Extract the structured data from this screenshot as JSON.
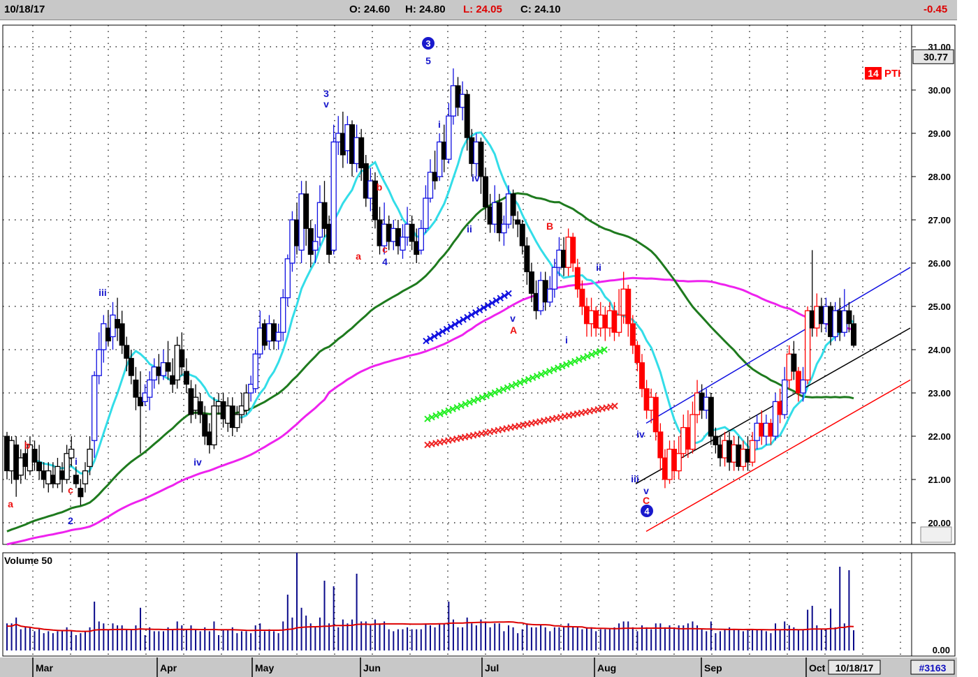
{
  "header": {
    "date": "10/18/17",
    "open": "O: 24.60",
    "high": "H: 24.80",
    "low": "L: 24.05",
    "close": "C: 24.10",
    "change": "-0.45"
  },
  "price_tag": "30.77",
  "pti": {
    "value": "14",
    "label": "PTI"
  },
  "volume_label": "Volume 50",
  "volume_axis_label": "0.00",
  "date_badge": "10/18/17",
  "chart_id": "#3163",
  "colors": {
    "up": "#1010e0",
    "down": "#000000",
    "red_phase": "#ff0000",
    "ma_fast": "#33dde8",
    "ma_mid": "#1e7a1e",
    "ma_slow": "#ee22ee",
    "volume": "#0a0a8a",
    "volume_avg": "#dd0000"
  },
  "chart_data": {
    "type": "candlestick",
    "y_ticks": [
      "31.00",
      "30.00",
      "29.00",
      "28.00",
      "27.00",
      "26.00",
      "25.00",
      "24.00",
      "23.00",
      "22.00",
      "21.00",
      "20.00"
    ],
    "ylim": [
      19.5,
      31.5
    ],
    "x_ticks": [
      "Mar",
      "Apr",
      "May",
      "Jun",
      "Jul",
      "Aug",
      "Sep",
      "Oct"
    ],
    "candles": [
      [
        22.0,
        21.2,
        22.1,
        21.0
      ],
      [
        21.2,
        21.9,
        22.0,
        20.9
      ],
      [
        21.8,
        21.0,
        22.0,
        20.6
      ],
      [
        21.1,
        21.5,
        21.7,
        20.9
      ],
      [
        21.6,
        21.3,
        21.9,
        21.0
      ],
      [
        21.2,
        21.8,
        22.0,
        21.1
      ],
      [
        21.7,
        21.4,
        21.9,
        21.2
      ],
      [
        21.4,
        21.2,
        21.8,
        21.0
      ],
      [
        21.2,
        21.0,
        21.4,
        20.8
      ],
      [
        20.9,
        21.2,
        21.4,
        20.7
      ],
      [
        21.1,
        20.9,
        21.4,
        20.8
      ],
      [
        20.9,
        21.3,
        21.5,
        20.8
      ],
      [
        21.2,
        21.0,
        21.4,
        20.7
      ],
      [
        21.0,
        21.6,
        21.8,
        20.9
      ],
      [
        21.5,
        21.7,
        22.0,
        21.3
      ],
      [
        21.1,
        20.9,
        21.3,
        20.8
      ],
      [
        20.8,
        20.6,
        21.0,
        20.4
      ],
      [
        20.9,
        21.2,
        21.4,
        20.7
      ],
      [
        21.3,
        21.7,
        22.0,
        21.1
      ],
      [
        21.9,
        23.4,
        23.5,
        21.5
      ],
      [
        23.4,
        24.0,
        24.4,
        23.2
      ],
      [
        24.0,
        24.6,
        24.8,
        23.7
      ],
      [
        24.5,
        24.2,
        24.9,
        24.1
      ],
      [
        24.3,
        24.8,
        25.1,
        24.0
      ],
      [
        24.7,
        24.5,
        25.2,
        24.2
      ],
      [
        24.6,
        24.1,
        24.9,
        23.9
      ],
      [
        24.1,
        23.8,
        24.3,
        23.5
      ],
      [
        23.8,
        23.4,
        24.0,
        23.2
      ],
      [
        23.3,
        22.9,
        23.6,
        22.6
      ],
      [
        22.9,
        22.7,
        23.5,
        21.6
      ],
      [
        22.8,
        23.0,
        23.2,
        22.7
      ],
      [
        22.9,
        23.3,
        23.5,
        22.6
      ],
      [
        23.3,
        23.6,
        23.8,
        23.1
      ],
      [
        23.6,
        23.4,
        23.9,
        23.2
      ],
      [
        23.4,
        23.7,
        24.0,
        23.3
      ],
      [
        23.7,
        23.5,
        24.2,
        23.3
      ],
      [
        23.4,
        23.2,
        23.8,
        23.0
      ],
      [
        23.3,
        24.1,
        24.3,
        23.1
      ],
      [
        24.0,
        23.6,
        24.4,
        23.4
      ],
      [
        23.5,
        23.2,
        23.8,
        23.0
      ],
      [
        23.1,
        22.5,
        23.3,
        22.3
      ],
      [
        22.6,
        22.9,
        23.2,
        22.4
      ],
      [
        22.8,
        22.5,
        23.0,
        22.3
      ],
      [
        22.5,
        22.0,
        22.7,
        21.8
      ],
      [
        22.1,
        21.8,
        22.3,
        21.6
      ],
      [
        21.8,
        22.7,
        22.9,
        21.7
      ],
      [
        22.7,
        22.8,
        23.0,
        22.5
      ],
      [
        22.8,
        22.4,
        23.0,
        22.2
      ],
      [
        22.3,
        22.7,
        22.9,
        22.1
      ],
      [
        22.7,
        22.2,
        22.9,
        22.0
      ],
      [
        22.2,
        22.5,
        22.7,
        22.1
      ],
      [
        22.5,
        22.7,
        23.0,
        22.3
      ],
      [
        22.6,
        23.0,
        23.2,
        22.5
      ],
      [
        23.0,
        23.2,
        23.4,
        22.8
      ],
      [
        23.1,
        23.9,
        24.0,
        23.0
      ],
      [
        23.9,
        24.5,
        24.9,
        23.8
      ],
      [
        24.6,
        24.1,
        24.7,
        24.0
      ],
      [
        24.2,
        24.6,
        24.8,
        24.0
      ],
      [
        24.6,
        24.2,
        24.7,
        24.0
      ],
      [
        24.2,
        24.4,
        24.6,
        24.0
      ],
      [
        24.4,
        25.2,
        25.4,
        24.2
      ],
      [
        25.2,
        26.1,
        26.2,
        25.0
      ],
      [
        26.0,
        27.0,
        27.2,
        25.8
      ],
      [
        27.0,
        26.4,
        27.4,
        26.2
      ],
      [
        26.3,
        27.6,
        27.9,
        26.0
      ],
      [
        27.6,
        26.8,
        27.9,
        26.4
      ],
      [
        26.8,
        26.2,
        27.0,
        25.9
      ],
      [
        26.3,
        26.5,
        26.9,
        26.0
      ],
      [
        26.6,
        27.4,
        27.8,
        26.4
      ],
      [
        27.4,
        26.8,
        27.9,
        26.6
      ],
      [
        26.9,
        26.2,
        27.1,
        26.0
      ],
      [
        26.3,
        28.8,
        29.2,
        26.2
      ],
      [
        28.8,
        29.0,
        29.4,
        28.5
      ],
      [
        29.0,
        28.5,
        29.5,
        28.2
      ],
      [
        28.6,
        29.2,
        29.4,
        28.3
      ],
      [
        29.2,
        28.3,
        29.3,
        28.0
      ],
      [
        28.3,
        28.9,
        29.2,
        28.1
      ],
      [
        28.9,
        28.2,
        29.1,
        27.9
      ],
      [
        28.3,
        27.5,
        28.5,
        27.3
      ],
      [
        27.5,
        27.9,
        28.2,
        27.2
      ],
      [
        27.9,
        27.0,
        28.1,
        26.8
      ],
      [
        27.0,
        26.4,
        27.3,
        26.2
      ],
      [
        26.4,
        26.9,
        27.4,
        26.2
      ],
      [
        26.9,
        26.5,
        27.1,
        26.3
      ],
      [
        26.5,
        26.8,
        27.0,
        26.3
      ],
      [
        26.8,
        26.4,
        27.0,
        26.2
      ],
      [
        26.3,
        26.6,
        26.9,
        26.1
      ],
      [
        26.6,
        26.9,
        27.3,
        26.4
      ],
      [
        26.9,
        26.5,
        27.1,
        26.3
      ],
      [
        26.5,
        26.2,
        26.8,
        26.0
      ],
      [
        26.3,
        26.8,
        27.0,
        26.2
      ],
      [
        26.8,
        27.5,
        27.8,
        26.7
      ],
      [
        27.5,
        28.1,
        28.4,
        27.4
      ],
      [
        28.1,
        27.9,
        28.6,
        27.7
      ],
      [
        28.0,
        28.8,
        29.0,
        27.9
      ],
      [
        28.8,
        28.4,
        29.2,
        28.1
      ],
      [
        28.4,
        29.4,
        29.7,
        28.3
      ],
      [
        29.4,
        30.1,
        30.5,
        29.2
      ],
      [
        30.1,
        29.6,
        30.3,
        29.4
      ],
      [
        29.6,
        29.9,
        30.2,
        29.3
      ],
      [
        29.9,
        28.9,
        30.0,
        28.6
      ],
      [
        28.9,
        28.3,
        29.1,
        28.0
      ],
      [
        28.3,
        28.8,
        29.0,
        28.0
      ],
      [
        28.8,
        28.0,
        28.9,
        27.6
      ],
      [
        28.0,
        27.3,
        28.2,
        27.0
      ],
      [
        27.3,
        26.9,
        27.6,
        26.7
      ],
      [
        26.9,
        27.4,
        27.8,
        26.7
      ],
      [
        27.4,
        26.7,
        27.6,
        26.5
      ],
      [
        26.7,
        26.9,
        27.1,
        26.4
      ],
      [
        26.9,
        27.6,
        27.8,
        26.8
      ],
      [
        27.6,
        27.1,
        27.7,
        26.8
      ],
      [
        27.0,
        26.9,
        27.2,
        26.6
      ],
      [
        26.9,
        26.4,
        27.0,
        26.2
      ],
      [
        26.4,
        25.8,
        26.6,
        25.5
      ],
      [
        25.8,
        25.3,
        26.0,
        25.1
      ],
      [
        25.3,
        24.9,
        25.6,
        24.7
      ],
      [
        24.9,
        25.6,
        25.8,
        24.8
      ],
      [
        25.6,
        25.1,
        25.8,
        24.9
      ],
      [
        25.1,
        25.4,
        25.7,
        25.0
      ],
      [
        25.4,
        25.9,
        26.1,
        25.2
      ],
      [
        25.9,
        26.3,
        26.6,
        25.7
      ],
      [
        26.3,
        25.9,
        26.6,
        25.7
      ],
      [
        25.9,
        26.6,
        26.8,
        25.7
      ],
      [
        26.6,
        26.0,
        26.7,
        25.8
      ],
      [
        25.9,
        25.4,
        26.1,
        25.2
      ],
      [
        25.4,
        25.0,
        25.6,
        24.8
      ],
      [
        25.0,
        24.6,
        25.2,
        24.3
      ],
      [
        24.6,
        24.9,
        25.2,
        24.3
      ],
      [
        24.9,
        24.5,
        25.0,
        24.3
      ],
      [
        24.5,
        24.8,
        25.1,
        24.3
      ],
      [
        24.8,
        24.5,
        25.0,
        24.2
      ],
      [
        24.5,
        24.9,
        25.1,
        24.3
      ],
      [
        24.9,
        24.4,
        25.1,
        24.2
      ],
      [
        24.4,
        24.8,
        25.4,
        24.3
      ],
      [
        24.8,
        25.4,
        25.8,
        24.6
      ],
      [
        25.4,
        24.6,
        25.5,
        24.3
      ],
      [
        24.6,
        24.1,
        24.8,
        23.9
      ],
      [
        24.1,
        23.7,
        24.2,
        23.5
      ],
      [
        23.7,
        23.1,
        23.9,
        22.9
      ],
      [
        23.1,
        22.6,
        23.3,
        22.4
      ],
      [
        22.6,
        22.9,
        23.1,
        22.3
      ],
      [
        22.9,
        22.1,
        23.0,
        21.9
      ],
      [
        22.1,
        21.5,
        22.3,
        21.2
      ],
      [
        21.5,
        21.0,
        21.7,
        20.8
      ],
      [
        21.0,
        21.7,
        21.9,
        20.9
      ],
      [
        21.7,
        21.2,
        21.9,
        21.0
      ],
      [
        21.2,
        21.6,
        22.0,
        21.0
      ],
      [
        21.6,
        22.2,
        22.5,
        21.5
      ],
      [
        22.2,
        21.7,
        22.6,
        21.5
      ],
      [
        21.7,
        22.5,
        22.8,
        21.6
      ],
      [
        22.5,
        23.0,
        23.3,
        22.3
      ],
      [
        23.0,
        22.6,
        23.2,
        22.4
      ],
      [
        22.6,
        22.9,
        23.1,
        22.4
      ],
      [
        22.9,
        22.0,
        23.0,
        21.8
      ],
      [
        22.0,
        21.8,
        22.2,
        21.6
      ],
      [
        21.8,
        21.5,
        22.0,
        21.3
      ],
      [
        21.5,
        21.9,
        22.1,
        21.3
      ],
      [
        21.9,
        21.4,
        22.1,
        21.2
      ],
      [
        21.4,
        21.8,
        22.0,
        21.2
      ],
      [
        21.8,
        21.3,
        22.0,
        21.2
      ],
      [
        21.3,
        21.7,
        21.9,
        21.2
      ],
      [
        21.7,
        21.4,
        22.0,
        21.2
      ],
      [
        21.4,
        21.9,
        22.1,
        21.3
      ],
      [
        21.9,
        22.3,
        22.5,
        21.7
      ],
      [
        22.3,
        22.0,
        22.6,
        21.8
      ],
      [
        22.0,
        22.3,
        22.5,
        21.8
      ],
      [
        22.3,
        22.0,
        22.4,
        21.8
      ],
      [
        22.0,
        22.8,
        23.0,
        21.9
      ],
      [
        22.8,
        22.5,
        23.1,
        22.3
      ],
      [
        22.5,
        23.3,
        23.6,
        22.4
      ],
      [
        23.3,
        23.9,
        24.1,
        23.1
      ],
      [
        23.9,
        23.5,
        24.2,
        23.3
      ],
      [
        23.5,
        23.0,
        23.6,
        22.8
      ],
      [
        23.0,
        23.3,
        23.6,
        22.8
      ],
      [
        23.3,
        24.9,
        25.0,
        23.2
      ],
      [
        24.9,
        24.5,
        26.3,
        24.3
      ],
      [
        24.5,
        25.0,
        25.3,
        24.3
      ],
      [
        25.0,
        24.6,
        25.2,
        24.4
      ],
      [
        24.6,
        25.0,
        25.2,
        24.4
      ],
      [
        25.0,
        24.3,
        25.1,
        24.1
      ],
      [
        24.3,
        24.9,
        25.1,
        24.2
      ],
      [
        24.9,
        24.4,
        25.2,
        24.2
      ],
      [
        24.4,
        24.9,
        25.4,
        24.3
      ],
      [
        24.9,
        24.6,
        25.1,
        24.4
      ],
      [
        24.6,
        24.1,
        24.8,
        24.05
      ]
    ],
    "volume_50_avg": "shown as red line"
  },
  "wave_labels": [
    {
      "text": "a",
      "c": "r"
    },
    {
      "text": "b",
      "c": "r"
    },
    {
      "text": "c",
      "c": "r"
    },
    {
      "text": "2",
      "c": "b"
    },
    {
      "text": "i",
      "c": "b"
    },
    {
      "text": "iii",
      "c": "b"
    },
    {
      "text": "iv",
      "c": "b"
    },
    {
      "text": "3",
      "c": "b"
    },
    {
      "text": "v",
      "c": "b"
    },
    {
      "text": "a",
      "c": "r"
    },
    {
      "text": "b",
      "c": "r"
    },
    {
      "text": "c",
      "c": "r"
    },
    {
      "text": "4",
      "c": "b"
    },
    {
      "text": "3",
      "c": "b"
    },
    {
      "text": "5",
      "c": "b"
    },
    {
      "text": "i",
      "c": "b"
    },
    {
      "text": "iv",
      "c": "b"
    },
    {
      "text": "ii",
      "c": "b"
    },
    {
      "text": "v",
      "c": "b"
    },
    {
      "text": "A",
      "c": "r"
    },
    {
      "text": "B",
      "c": "r"
    },
    {
      "text": "i",
      "c": "b"
    },
    {
      "text": "ii",
      "c": "b"
    },
    {
      "text": "iv",
      "c": "b"
    },
    {
      "text": "iii",
      "c": "b"
    },
    {
      "text": "v",
      "c": "b"
    },
    {
      "text": "C",
      "c": "r"
    },
    {
      "text": "4",
      "c": "b"
    }
  ]
}
